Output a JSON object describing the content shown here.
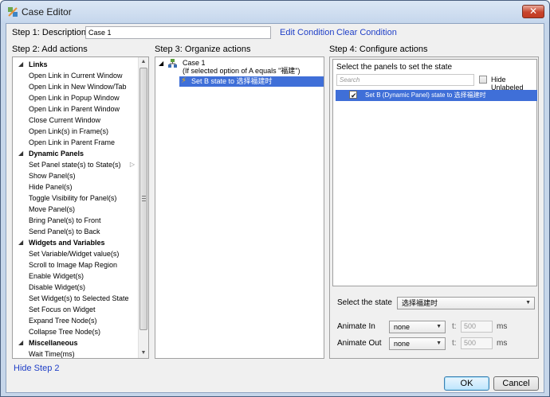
{
  "window": {
    "title": "Case Editor",
    "close_label": "✕"
  },
  "step1": {
    "label": "Step 1: Description",
    "description_value": "Case 1",
    "edit_condition": "Edit Condition",
    "clear_condition": "Clear Condition"
  },
  "step2": {
    "label": "Step 2: Add actions",
    "groups": [
      {
        "name": "Links",
        "items": [
          "Open Link in Current Window",
          "Open Link in New Window/Tab",
          "Open Link in Popup Window",
          "Open Link in Parent Window",
          "Close Current Window",
          "Open Link(s) in Frame(s)",
          "Open Link in Parent Frame"
        ]
      },
      {
        "name": "Dynamic Panels",
        "items": [
          "Set Panel state(s) to State(s)",
          "Show Panel(s)",
          "Hide Panel(s)",
          "Toggle Visibility for Panel(s)",
          "Move Panel(s)",
          "Bring Panel(s) to Front",
          "Send Panel(s) to Back"
        ]
      },
      {
        "name": "Widgets and Variables",
        "items": [
          "Set Variable/Widget value(s)",
          "Scroll to Image Map Region",
          "Enable Widget(s)",
          "Disable Widget(s)",
          "Set Widget(s) to Selected State",
          "Set Focus on Widget",
          "Expand Tree Node(s)",
          "Collapse Tree Node(s)"
        ]
      },
      {
        "name": "Miscellaneous",
        "items": [
          "Wait Time(ms)"
        ]
      }
    ],
    "hide_step": "Hide Step 2"
  },
  "step3": {
    "label": "Step 3: Organize actions",
    "case_name": "Case 1",
    "case_condition": "(If selected option of A equals \"福建\")",
    "action": "Set B state to 选择福建时"
  },
  "step4": {
    "label": "Step 4: Configure actions",
    "panel_title": "Select the panels to set the state",
    "search_placeholder": "Search",
    "hide_unlabeled": "Hide Unlabeled",
    "panel_row": "Set B (Dynamic Panel) state to 选择福建时",
    "select_state_label": "Select the state",
    "select_state_value": "选择福建时",
    "animate_in_label": "Animate In",
    "animate_in_value": "none",
    "animate_out_label": "Animate Out",
    "animate_out_value": "none",
    "t_label": "t:",
    "t_in": "500",
    "t_out": "500",
    "ms_label": "ms"
  },
  "buttons": {
    "ok": "OK",
    "cancel": "Cancel"
  },
  "colors": {
    "selection": "#3f6fd8",
    "link": "#1f3fc7",
    "close": "#c7442d"
  }
}
